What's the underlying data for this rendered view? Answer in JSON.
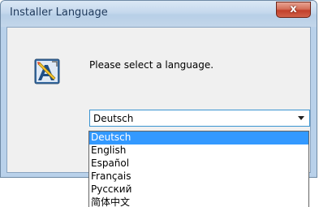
{
  "window": {
    "title": "Installer Language",
    "close_glyph": "x"
  },
  "content": {
    "prompt": "Please select a language.",
    "icon": "installer-icon"
  },
  "language_select": {
    "value": "Deutsch",
    "options": [
      {
        "label": "Deutsch",
        "selected": true
      },
      {
        "label": "English",
        "selected": false
      },
      {
        "label": "Español",
        "selected": false
      },
      {
        "label": "Français",
        "selected": false
      },
      {
        "label": "Русский",
        "selected": false
      },
      {
        "label": "简体中文",
        "selected": false
      }
    ]
  },
  "colors": {
    "highlight": "#3399ff",
    "window_frame": "#b9d1ea",
    "close_button": "#c2402a"
  }
}
